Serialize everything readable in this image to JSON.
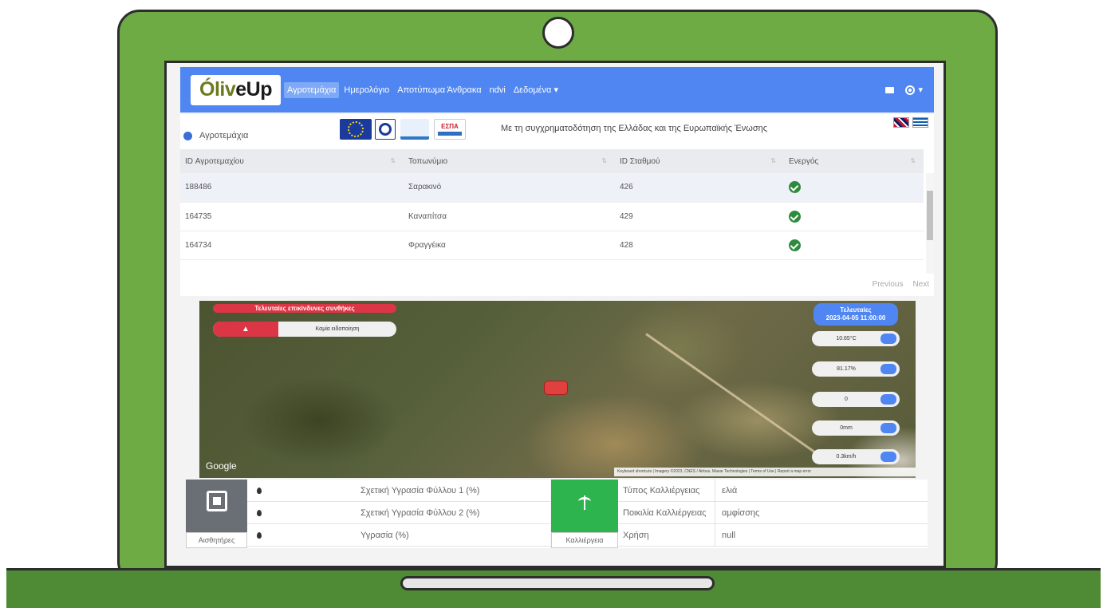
{
  "navbar": {
    "logo_part1": "Óliv",
    "logo_part2": "eUp",
    "items": [
      {
        "label": "Αγροτεμάχια"
      },
      {
        "label": "Ημερολόγιο"
      },
      {
        "label": "Αποτύπωμα Άνθρακα"
      },
      {
        "label": "ndvi"
      },
      {
        "label": "Δεδομένα ▾"
      }
    ],
    "user_caret": "▾"
  },
  "subheader": {
    "breadcrumb": "Αγροτεμάχια",
    "funding_text": "Με τη συγχρηματοδότηση της Ελλάδας και της Ευρωπαϊκής Ένωσης",
    "espa_label": "ΕΣΠΑ"
  },
  "table": {
    "headers": [
      "ID Αγροτεμαχίου",
      "Τοπωνύμιο",
      "ID Σταθμού",
      "Ενεργός"
    ],
    "sort_symbol": "⇅",
    "rows": [
      {
        "id": "188486",
        "place": "Σαρακινό",
        "station": "426"
      },
      {
        "id": "164735",
        "place": "Καναπίτσα",
        "station": "429"
      },
      {
        "id": "164734",
        "place": "Φραγγέικα",
        "station": "428"
      }
    ],
    "prev_label": "Previous",
    "next_label": "Next"
  },
  "map": {
    "alert_title": "Τελευταίες επικίνδυνες συνθήκες",
    "warn_symbol": "▲",
    "alert_text": "Καμία ειδοποίηση",
    "latest_title": "Τελευταίες",
    "latest_time": "2023-04-05 11:00:00",
    "metrics": [
      "10.65°C",
      "81.17%",
      "0",
      "0mm",
      "0.3km/h"
    ],
    "google": "Google",
    "attribution": "Keyboard shortcuts | Imagery ©2023, CNES / Airbus, Maxar Technologies | Terms of Use | Report a map error"
  },
  "sensors": {
    "tile_label": "Αισθητήρες",
    "rows": [
      {
        "label": "Σχετική Υγρασία Φύλλου 1 (%)"
      },
      {
        "label": "Σχετική Υγρασία Φύλλου 2 (%)"
      },
      {
        "label": "Υγρασία (%)"
      }
    ]
  },
  "crop": {
    "tile_label": "Καλλιέργεια",
    "rows": [
      {
        "key": "Τύπος Καλλιέργειας",
        "value": "ελιά"
      },
      {
        "key": "Ποικιλία Καλλιέργειας",
        "value": "αμφίσσης"
      },
      {
        "key": "Χρήση",
        "value": "null"
      }
    ]
  }
}
